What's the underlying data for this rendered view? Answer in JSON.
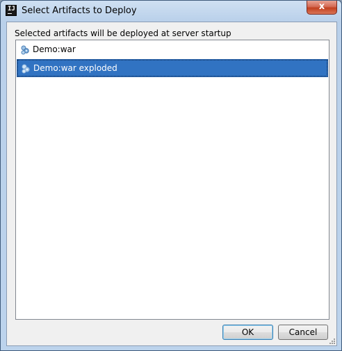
{
  "window": {
    "title": "Select Artifacts to Deploy",
    "close_glyph": "x",
    "app_icon_text": "IJ"
  },
  "description": "Selected artifacts will be deployed at server startup",
  "artifacts": [
    {
      "label": "Demo:war",
      "icon": "artifact-icon",
      "selected": false
    },
    {
      "label": "Demo:war exploded",
      "icon": "artifact-icon",
      "selected": true
    }
  ],
  "buttons": {
    "ok": "OK",
    "cancel": "Cancel"
  },
  "colors": {
    "selection": "#3173c2",
    "title_gradient": "#bcd3ec",
    "close_button": "#c2401f"
  }
}
